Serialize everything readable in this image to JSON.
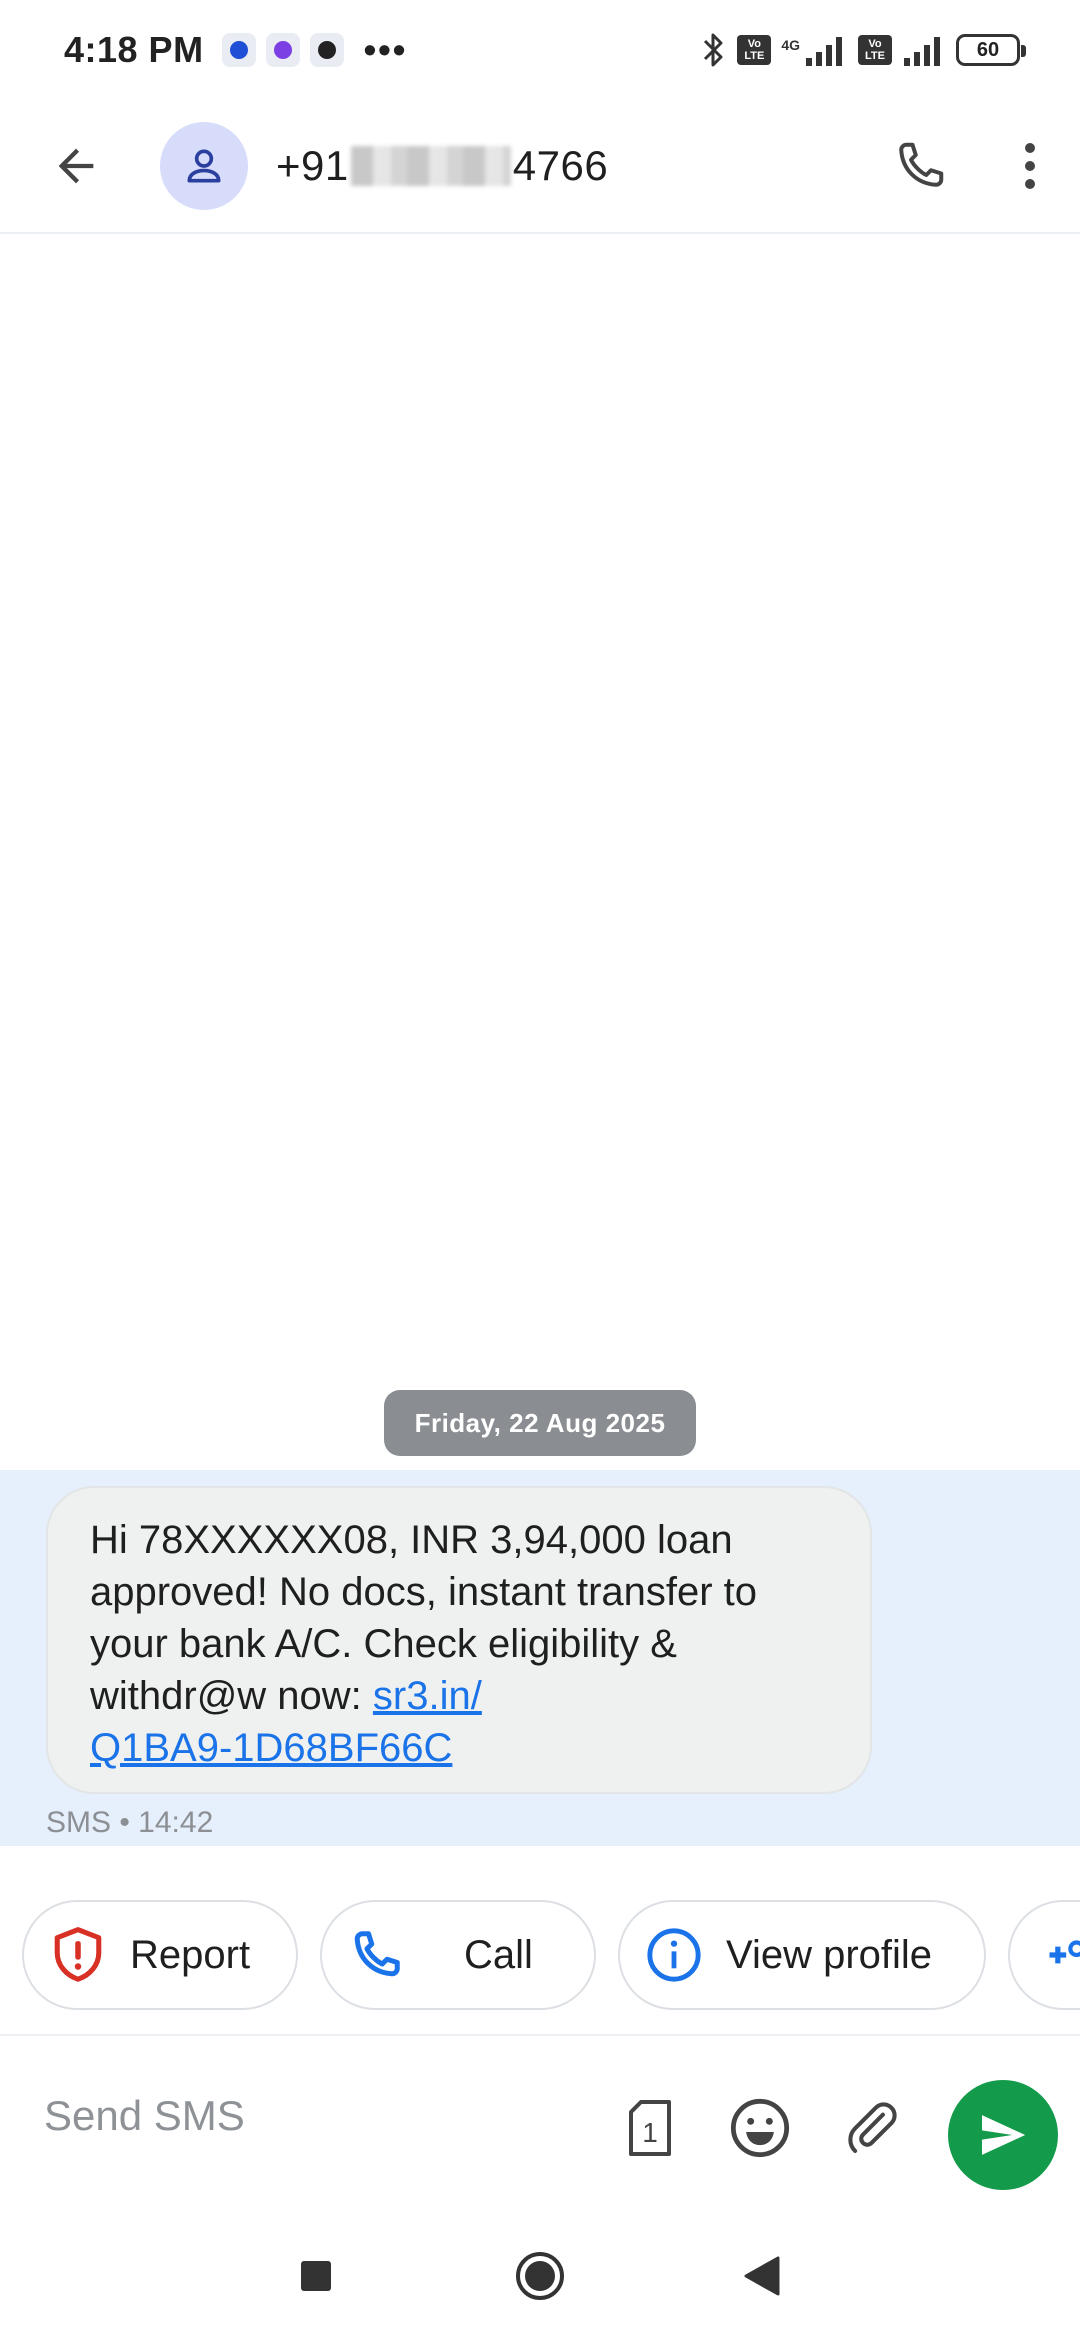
{
  "status_bar": {
    "time": "4:18 PM",
    "more": "•••",
    "network": "4G",
    "volte_top": "Vo",
    "volte_bottom": "LTE",
    "battery": "60"
  },
  "header": {
    "number_prefix": "+91",
    "number_suffix": "4766"
  },
  "conversation": {
    "date_label": "Friday, 22 Aug 2025",
    "message": {
      "text": "Hi 78XXXXXX08, INR 3,94,000 loan approved! No docs, instant transfer to your bank A/C. Check eligibility & withdr@w now: ",
      "link_part1": "sr3.in/",
      "link_part2": "Q1BA9-1D68BF66C",
      "meta": "SMS • 14:42"
    }
  },
  "suggestions": [
    {
      "label": "Report",
      "icon": "shield-alert-icon"
    },
    {
      "label": "Call",
      "icon": "phone-icon"
    },
    {
      "label": "View profile",
      "icon": "info-icon"
    }
  ],
  "compose": {
    "placeholder": "Send SMS",
    "sim_label": "1"
  },
  "colors": {
    "accent_blue": "#1a73e8",
    "send_green": "#139a4b",
    "report_red": "#d93025",
    "highlight": "#e6effc"
  }
}
